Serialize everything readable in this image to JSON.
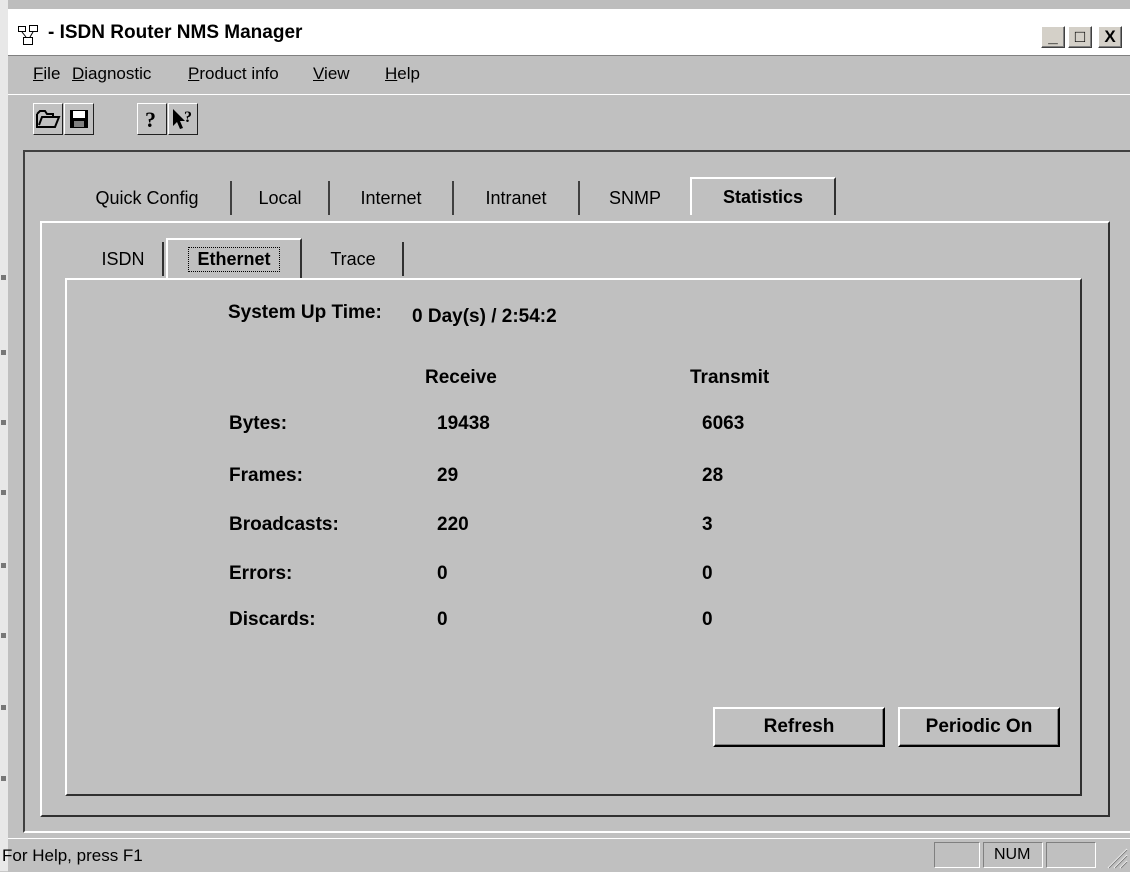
{
  "window": {
    "title": "- ISDN Router NMS Manager",
    "controls": [
      "_",
      "□",
      "X"
    ]
  },
  "menu": [
    {
      "label": "File"
    },
    {
      "label": "Diagnostic"
    },
    {
      "label": "Product info"
    },
    {
      "label": "View"
    },
    {
      "label": "Help"
    }
  ],
  "toolbar": {
    "buttons": [
      "open-icon",
      "save-icon",
      "help-icon",
      "context-help-icon"
    ]
  },
  "tabs": [
    {
      "label": "Quick Config",
      "active": false
    },
    {
      "label": "Local",
      "active": false
    },
    {
      "label": "Internet",
      "active": false
    },
    {
      "label": "Intranet",
      "active": false
    },
    {
      "label": "SNMP",
      "active": false
    },
    {
      "label": "Statistics",
      "active": true
    }
  ],
  "subtabs": [
    {
      "label": "ISDN",
      "active": false
    },
    {
      "label": "Ethernet",
      "active": true
    },
    {
      "label": "Trace",
      "active": false
    }
  ],
  "stats": {
    "uptime_label": "System Up Time:",
    "uptime_value": "0 Day(s) / 2:54:2",
    "receive_header": "Receive",
    "transmit_header": "Transmit",
    "rows": [
      {
        "label": "Bytes:",
        "receive": "19438",
        "transmit": "6063"
      },
      {
        "label": "Frames:",
        "receive": "29",
        "transmit": "28"
      },
      {
        "label": "Broadcasts:",
        "receive": "220",
        "transmit": "3"
      },
      {
        "label": "Errors:",
        "receive": "0",
        "transmit": "0"
      },
      {
        "label": "Discards:",
        "receive": "0",
        "transmit": "0"
      }
    ]
  },
  "buttons": {
    "refresh": "Refresh",
    "periodic": "Periodic On"
  },
  "status": {
    "help_text": "For Help, press F1",
    "indicators": [
      "",
      "NUM",
      ""
    ]
  }
}
